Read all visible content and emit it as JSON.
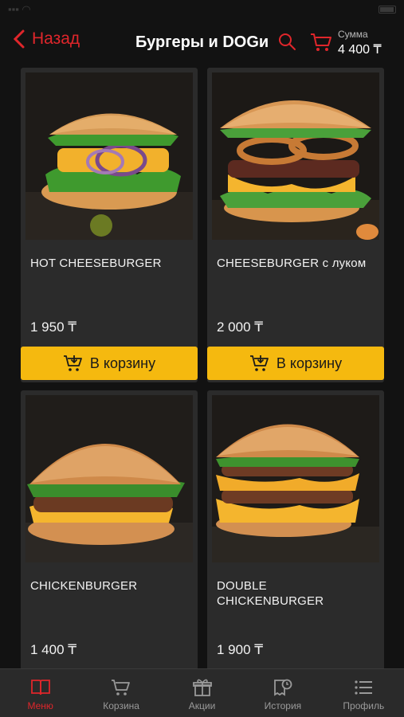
{
  "header": {
    "back_label": "Назад",
    "title": "Бургеры и DOGи",
    "sum_label": "Сумма",
    "sum_value": "4 400 ₸"
  },
  "products": [
    {
      "name": "HOT CHEESEBURGER",
      "price": "1 950 ₸",
      "button_label": "В корзину"
    },
    {
      "name": "CHEESEBURGER с луком",
      "price": "2 000 ₸",
      "button_label": "В корзину"
    },
    {
      "name": "CHICKENBURGER",
      "price": "1 400 ₸"
    },
    {
      "name": "DOUBLE CHICKENBURGER",
      "price": "1 900 ₸"
    }
  ],
  "tabbar": {
    "items": [
      {
        "label": "Меню",
        "icon": "book-icon",
        "active": true
      },
      {
        "label": "Корзина",
        "icon": "cart-icon",
        "active": false
      },
      {
        "label": "Акции",
        "icon": "gift-icon",
        "active": false
      },
      {
        "label": "История",
        "icon": "history-icon",
        "active": false
      },
      {
        "label": "Профиль",
        "icon": "list-icon",
        "active": false
      }
    ]
  },
  "colors": {
    "accent_red": "#e0262b",
    "button_yellow": "#f5b90f",
    "card_bg": "#2b2b2b",
    "page_bg": "#121212"
  }
}
